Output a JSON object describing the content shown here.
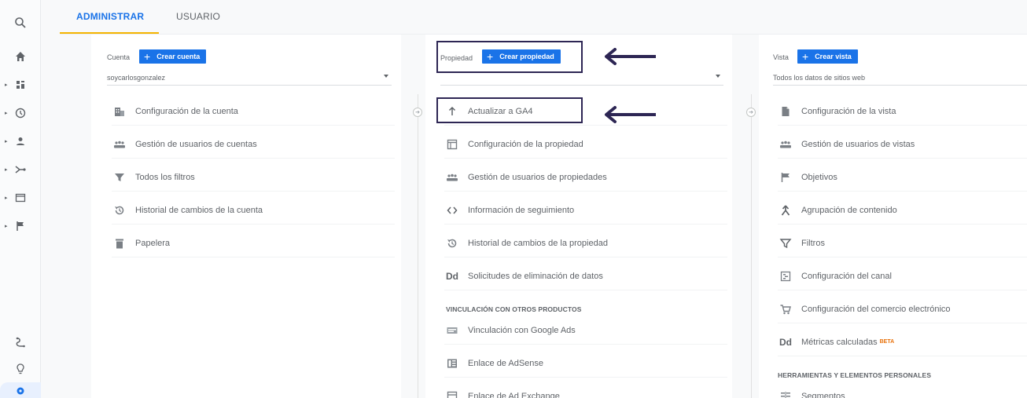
{
  "tabs": [
    {
      "label": "ADMINISTRAR",
      "active": true
    },
    {
      "label": "USUARIO",
      "active": false
    }
  ],
  "rail_icons": [
    "search-icon",
    "home-icon",
    "dashboard-icon",
    "clock-icon",
    "person-icon",
    "acquisition-icon",
    "behavior-icon",
    "flag-icon",
    "route-icon",
    "lightbulb-icon",
    "settings-icon"
  ],
  "account": {
    "label": "Cuenta",
    "create_label": "Crear cuenta",
    "selected": "soycarlosgonzalez",
    "items": [
      {
        "label": "Configuración de la cuenta",
        "icon": "building-icon"
      },
      {
        "label": "Gestión de usuarios de cuentas",
        "icon": "people-icon"
      },
      {
        "label": "Todos los filtros",
        "icon": "filter-icon"
      },
      {
        "label": "Historial de cambios de la cuenta",
        "icon": "history-icon"
      },
      {
        "label": "Papelera",
        "icon": "trash-icon"
      }
    ]
  },
  "property": {
    "label": "Propiedad",
    "create_label": "Crear propiedad",
    "selected": "",
    "items": [
      {
        "label": "Actualizar a GA4",
        "icon": "arrow-up-icon"
      },
      {
        "label": "Configuración de la propiedad",
        "icon": "window-icon"
      },
      {
        "label": "Gestión de usuarios de propiedades",
        "icon": "people-icon"
      },
      {
        "label": "Información de seguimiento",
        "icon": "code-icon"
      },
      {
        "label": "Historial de cambios de la propiedad",
        "icon": "history-icon"
      },
      {
        "label": "Solicitudes de eliminación de datos",
        "icon": "dd-icon",
        "glyph": "Dd"
      }
    ],
    "section_label": "VINCULACIÓN CON OTROS PRODUCTOS",
    "links": [
      {
        "label": "Vinculación con Google Ads",
        "icon": "ads-icon"
      },
      {
        "label": "Enlace de AdSense",
        "icon": "adsense-icon"
      },
      {
        "label": "Enlace de Ad Exchange",
        "icon": "adexchange-icon"
      }
    ]
  },
  "view": {
    "label": "Vista",
    "create_label": "Crear vista",
    "selected": "Todos los datos de sitios web",
    "items": [
      {
        "label": "Configuración de la vista",
        "icon": "document-icon"
      },
      {
        "label": "Gestión de usuarios de vistas",
        "icon": "people-icon"
      },
      {
        "label": "Objetivos",
        "icon": "flag-icon"
      },
      {
        "label": "Agrupación de contenido",
        "icon": "merge-icon"
      },
      {
        "label": "Filtros",
        "icon": "filter-icon"
      },
      {
        "label": "Configuración del canal",
        "icon": "channel-icon"
      },
      {
        "label": "Configuración del comercio electrónico",
        "icon": "cart-icon"
      },
      {
        "label": "Métricas calculadas",
        "icon": "dd-icon",
        "glyph": "Dd",
        "badge": "BETA"
      }
    ],
    "section_label": "HERRAMIENTAS Y ELEMENTOS PERSONALES",
    "tools": [
      {
        "label": "Segmentos",
        "icon": "segments-icon"
      }
    ]
  },
  "colors": {
    "accent": "#1a73e8",
    "tab_underline": "#f4b400",
    "annotation": "#2d2654",
    "beta": "#e8710a"
  }
}
